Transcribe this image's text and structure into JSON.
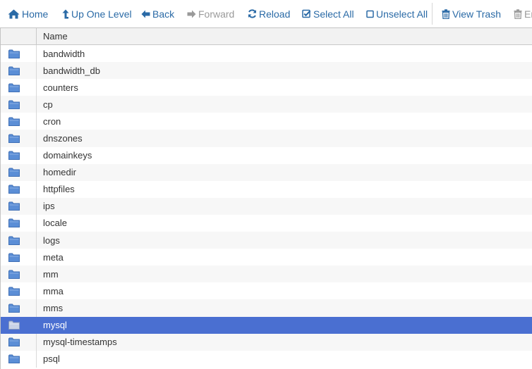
{
  "toolbar": {
    "home_label": "Home",
    "up_label": "Up One Level",
    "back_label": "Back",
    "forward_label": "Forward",
    "reload_label": "Reload",
    "select_all_label": "Select All",
    "unselect_all_label": "Unselect All",
    "view_trash_label": "View Trash",
    "empty_trash_label": "Er"
  },
  "table": {
    "name_header": "Name",
    "rows": [
      {
        "name": "bandwidth"
      },
      {
        "name": "bandwidth_db"
      },
      {
        "name": "counters"
      },
      {
        "name": "cp"
      },
      {
        "name": "cron"
      },
      {
        "name": "dnszones"
      },
      {
        "name": "domainkeys"
      },
      {
        "name": "homedir"
      },
      {
        "name": "httpfiles"
      },
      {
        "name": "ips"
      },
      {
        "name": "locale"
      },
      {
        "name": "logs"
      },
      {
        "name": "meta"
      },
      {
        "name": "mm"
      },
      {
        "name": "mma"
      },
      {
        "name": "mms"
      },
      {
        "name": "mysql",
        "selected": true
      },
      {
        "name": "mysql-timestamps"
      },
      {
        "name": "psql"
      }
    ]
  },
  "colors": {
    "accent": "#2a6aa6",
    "disabled": "#9a9a9a",
    "selection": "#4a6fd1",
    "folder": "#5b8ed6"
  }
}
